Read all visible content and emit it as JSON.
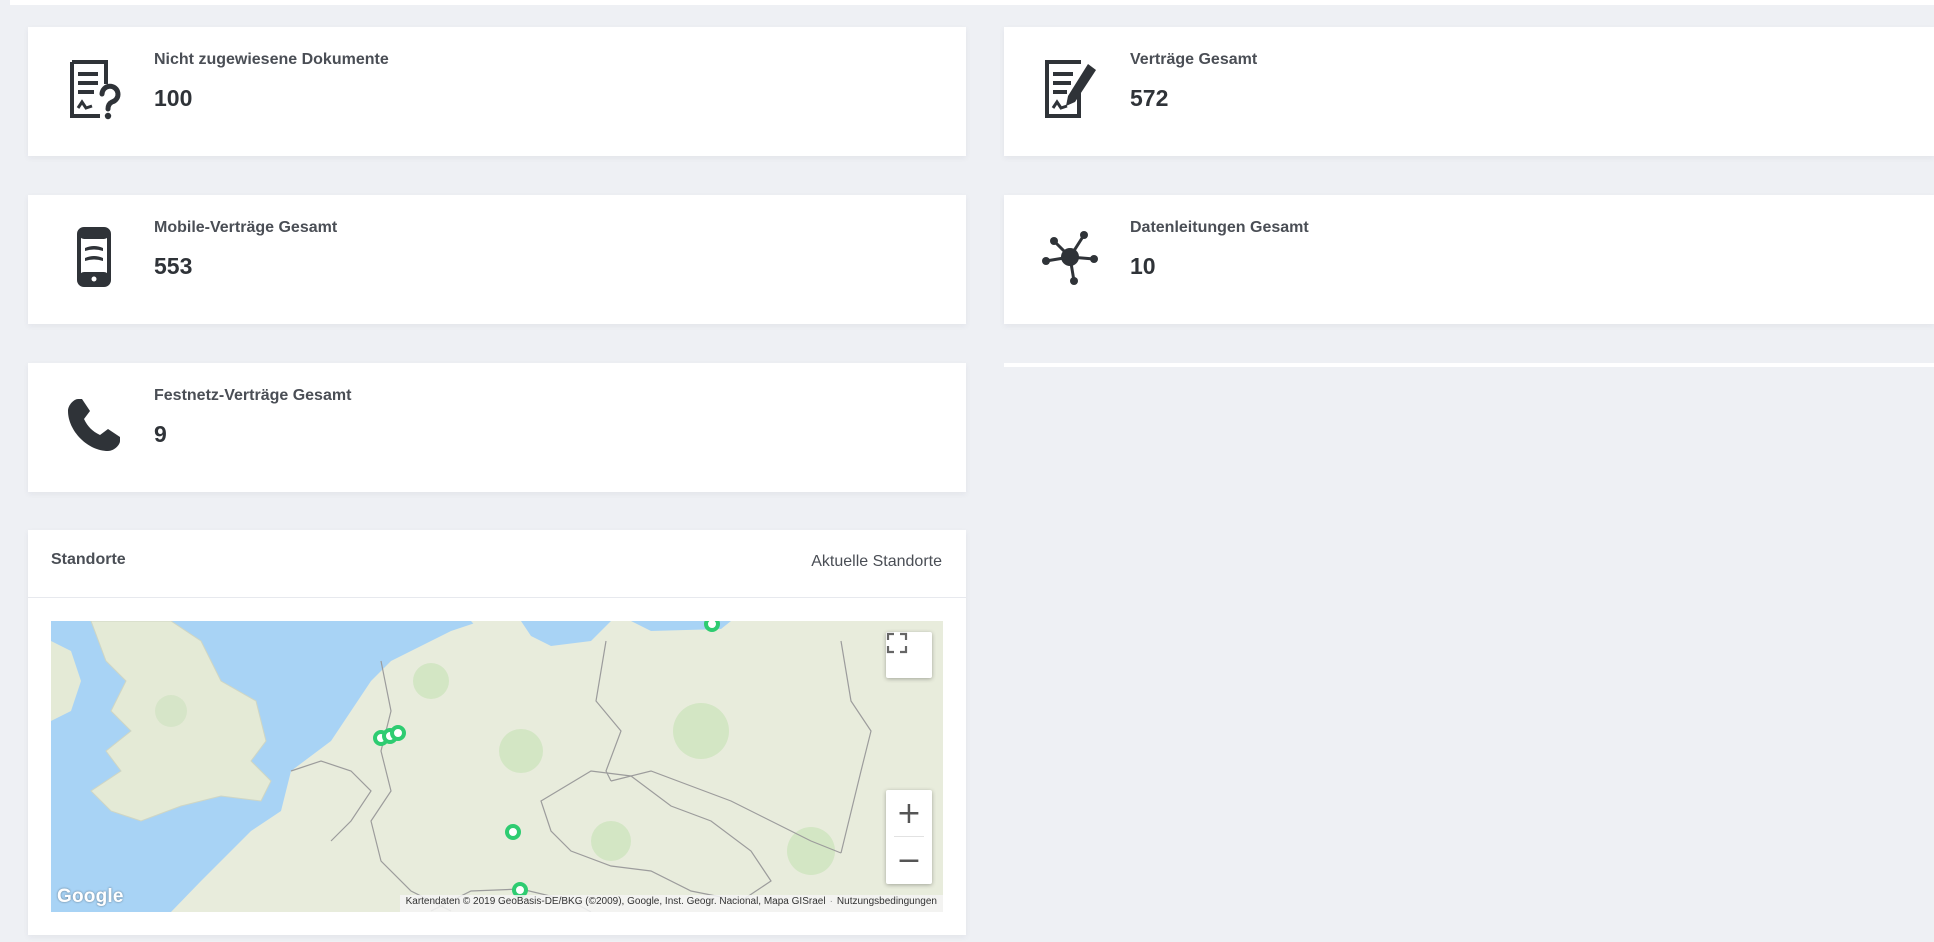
{
  "stats": {
    "unassigned_docs": {
      "label": "Nicht zugewiesene Dokumente",
      "value": "100",
      "icon": "document-question-icon"
    },
    "contracts_total": {
      "label": "Verträge Gesamt",
      "value": "572",
      "icon": "document-edit-icon"
    },
    "mobile_contracts": {
      "label": "Mobile-Verträge Gesamt",
      "value": "553",
      "icon": "mobile-phone-icon"
    },
    "data_lines": {
      "label": "Datenleitungen Gesamt",
      "value": "10",
      "icon": "network-hub-icon"
    },
    "landline_contracts": {
      "label": "Festnetz-Verträge Gesamt",
      "value": "9",
      "icon": "phone-icon"
    }
  },
  "locations": {
    "title": "Standorte",
    "subtitle": "Aktuelle Standorte",
    "map": {
      "google_label": "Google",
      "attribution": "Kartendaten © 2019 GeoBasis-DE/BKG (©2009), Google, Inst. Geogr. Nacional, Mapa GISrael",
      "terms": "Nutzungsbedingungen",
      "zoom_in": "+",
      "zoom_out": "−",
      "marker_color": "#2ecc71",
      "water_color": "#a8d3f5",
      "land_color": "#e8ecdc"
    }
  },
  "colors": {
    "background": "#eef0f4",
    "card": "#ffffff",
    "icon": "#2f3338"
  }
}
